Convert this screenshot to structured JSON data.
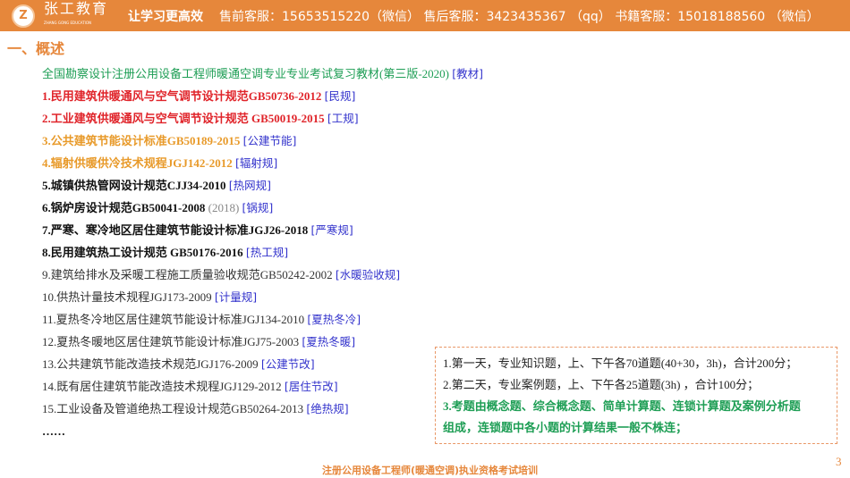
{
  "header": {
    "logo_mark": "Z",
    "brand": "张工教育",
    "brand_sub": "ZHANG GONG EDUCATION",
    "slogan": "让学习更高效",
    "contact": "售前客服：15653515220（微信） 售后客服：3423435367 （qq） 书籍客服：15018188560 （微信）"
  },
  "section_title": "一、概述",
  "list": [
    {
      "text": "全国勘察设计注册公用设备工程师暖通空调专业专业考试复习教材(第三版-2020)",
      "extra": "",
      "tag": "[教材]",
      "style": "green"
    },
    {
      "text": "1.民用建筑供暖通风与空气调节设计规范GB50736-2012",
      "extra": "",
      "tag": "[民规]",
      "style": "red"
    },
    {
      "text": "2.工业建筑供暖通风与空气调节设计规范 GB50019-2015",
      "extra": "",
      "tag": "[工规]",
      "style": "red"
    },
    {
      "text": "3.公共建筑节能设计标准GB50189-2015",
      "extra": "",
      "tag": "[公建节能]",
      "style": "orange"
    },
    {
      "text": "4.辐射供暖供冷技术规程JGJ142-2012",
      "extra": "",
      "tag": "[辐射规]",
      "style": "orange"
    },
    {
      "text": "5.城镇供热管网设计规范CJJ34-2010",
      "extra": "",
      "tag": "[热网规]",
      "style": "black"
    },
    {
      "text": "6.锅炉房设计规范GB50041-2008",
      "extra": "(2018)",
      "tag": "[锅规]",
      "style": "black"
    },
    {
      "text": "7.严寒、寒冷地区居住建筑节能设计标准JGJ26-2018",
      "extra": "",
      "tag": "[严寒规]",
      "style": "black"
    },
    {
      "text": "8.民用建筑热工设计规范 GB50176-2016",
      "extra": "",
      "tag": "[热工规]",
      "style": "black"
    },
    {
      "text": "9.建筑给排水及采暖工程施工质量验收规范GB50242-2002",
      "extra": "",
      "tag": "[水暖验收规]",
      "style": "plain"
    },
    {
      "text": "10.供热计量技术规程JGJ173-2009",
      "extra": "",
      "tag": "[计量规]",
      "style": "plain"
    },
    {
      "text": "11.夏热冬冷地区居住建筑节能设计标准JGJ134-2010",
      "extra": "",
      "tag": "[夏热冬冷]",
      "style": "plain"
    },
    {
      "text": "12.夏热冬暖地区居住建筑节能设计标准JGJ75-2003",
      "extra": "",
      "tag": "[夏热冬暖]",
      "style": "plain"
    },
    {
      "text": "13.公共建筑节能改造技术规范JGJ176-2009",
      "extra": "",
      "tag": "[公建节改]",
      "style": "plain"
    },
    {
      "text": "14.既有居住建筑节能改造技术规程JGJ129-2012",
      "extra": "",
      "tag": "[居住节改]",
      "style": "plain"
    },
    {
      "text": "15.工业设备及管道绝热工程设计规范GB50264-2013",
      "extra": "",
      "tag": "[绝热规]",
      "style": "plain"
    },
    {
      "text": "……",
      "extra": "",
      "tag": "",
      "style": "black"
    }
  ],
  "exam_box": [
    "1.第一天，专业知识题，上、下午各70道题(40+30，3h)，合计200分；",
    "2.第二天，专业案例题，上、下午各25道题(3h) ，合计100分；",
    "3.考题由概念题、综合概念题、简单计算题、连锁计算题及案例分析题",
    "组成，连锁题中各小题的计算结果一般不株连；"
  ],
  "footer": "注册公用设备工程师(暖通空调)执业资格考试培训",
  "page_number": "3"
}
